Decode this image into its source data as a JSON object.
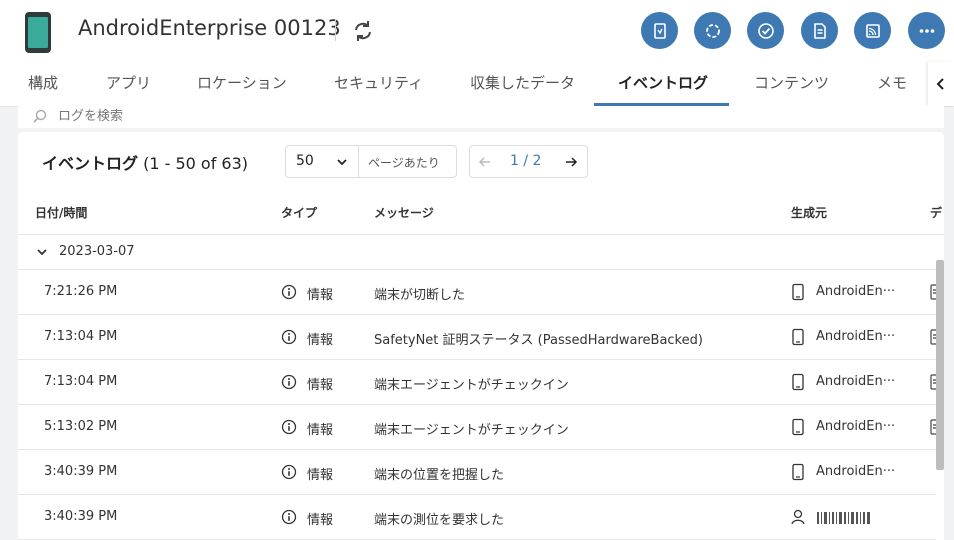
{
  "header": {
    "device_title": "AndroidEnterprise 00123",
    "actions": [
      {
        "icon": "remote-control-icon"
      },
      {
        "icon": "sync-icon"
      },
      {
        "icon": "check-icon"
      },
      {
        "icon": "document-icon"
      },
      {
        "icon": "cast-icon"
      },
      {
        "icon": "more-icon"
      }
    ],
    "accent_color": "#3e79b3"
  },
  "tabs": [
    {
      "label": "構成"
    },
    {
      "label": "アプリ"
    },
    {
      "label": "ロケーション"
    },
    {
      "label": "セキュリティ"
    },
    {
      "label": "収集したデータ"
    },
    {
      "label": "イベントログ",
      "active": true
    },
    {
      "label": "コンテンツ"
    },
    {
      "label": "メモ"
    }
  ],
  "search": {
    "placeholder": "ログを検索"
  },
  "event_log": {
    "title": "イベントログ",
    "range": "(1 - 50 of 63)",
    "page_size": "50",
    "per_page_label": "ページあたり",
    "page_indicator": "1 / 2",
    "columns": {
      "datetime": "日付/時間",
      "type": "タイプ",
      "message": "メッセージ",
      "source": "生成元",
      "truncated": "デ"
    },
    "group_date": "2023-03-07",
    "rows": [
      {
        "time": "7:21:26 PM",
        "type": "情報",
        "message": "端末が切断した",
        "source": "AndroidEn···"
      },
      {
        "time": "7:13:04 PM",
        "type": "情報",
        "message": "SafetyNet 証明ステータス (PassedHardwareBacked)",
        "source": "AndroidEn···"
      },
      {
        "time": "7:13:04 PM",
        "type": "情報",
        "message": "端末エージェントがチェックイン",
        "source": "AndroidEn···"
      },
      {
        "time": "5:13:02 PM",
        "type": "情報",
        "message": "端末エージェントがチェックイン",
        "source": "AndroidEn···"
      },
      {
        "time": "3:40:39 PM",
        "type": "情報",
        "message": "端末の位置を把握した",
        "source": "AndroidEn···"
      },
      {
        "time": "3:40:39 PM",
        "type": "情報",
        "message": "端末の測位を要求した",
        "source": ""
      }
    ]
  }
}
